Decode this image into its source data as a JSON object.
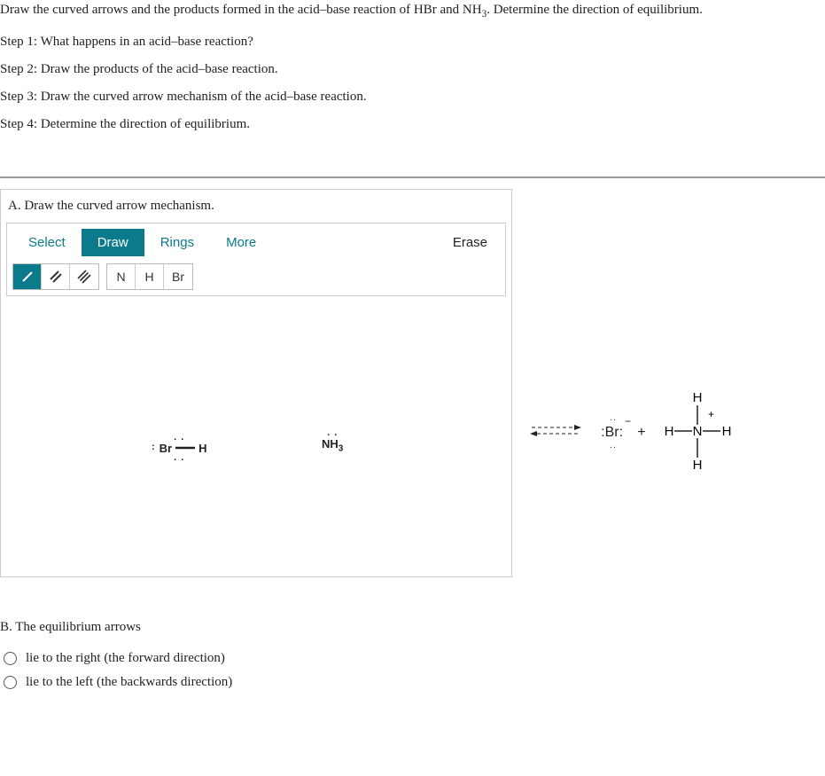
{
  "question": {
    "prompt_prefix": "Draw the curved arrows and the products formed in the acid–base reaction of HBr and NH",
    "prompt_sub": "3",
    "prompt_suffix": ". Determine the direction of equilibrium.",
    "step1": "Step 1: What happens in an acid–base reaction?",
    "step2": "Step 2: Draw the products of the acid–base reaction.",
    "step3": "Step 3: Draw the curved arrow mechanism of the acid–base reaction.",
    "step4": "Step 4: Determine the direction of equilibrium."
  },
  "partA": {
    "title": "A. Draw the curved arrow mechanism.",
    "tabs": {
      "select": "Select",
      "draw": "Draw",
      "rings": "Rings",
      "more": "More",
      "erase": "Erase"
    },
    "atoms": {
      "n": "N",
      "h": "H",
      "br": "Br"
    },
    "canvas": {
      "hbr_br": "Br",
      "hbr_h": "H",
      "nh3": "NH",
      "nh3_sub": "3"
    }
  },
  "products": {
    "br_label": ":Br:",
    "plus": "+",
    "nh4_h": "H",
    "nh4_n": "N",
    "charge": "+"
  },
  "partB": {
    "title": "B. The equilibrium arrows",
    "opt1": "lie to the right (the forward direction)",
    "opt2": "lie to the left (the backwards direction)"
  }
}
